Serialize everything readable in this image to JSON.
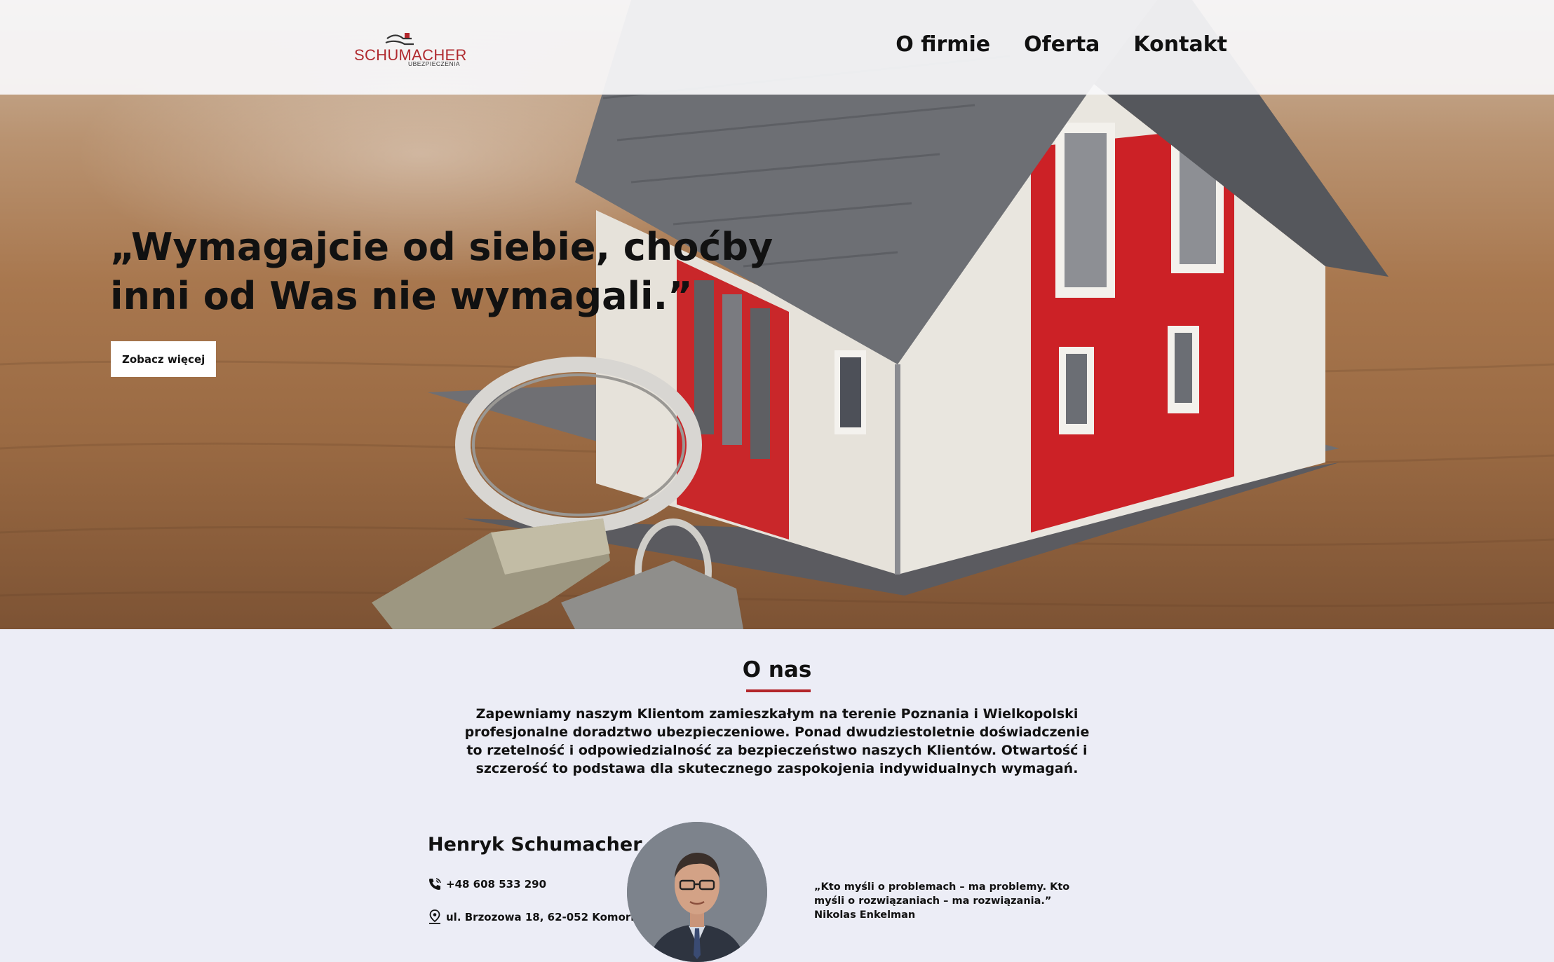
{
  "brand": {
    "name": "SCHUMACHER",
    "sub": "UBEZPIECZENIA",
    "accent": "#b3262b"
  },
  "nav": {
    "items": [
      {
        "label": "O firmie"
      },
      {
        "label": "Oferta"
      },
      {
        "label": "Kontakt"
      }
    ]
  },
  "hero": {
    "quote": "„Wymagajcie od siebie, choćby inni od Was nie wymagali.”",
    "button_label": "Zobacz więcej",
    "image": "house-and-keys-photo"
  },
  "about": {
    "title": "O nas",
    "text": "Zapewniamy naszym Klientom zamieszkałym na terenie Poznania i Wielkopolski profesjonalne doradztwo ubezpieczeniowe. Ponad dwudziestoletnie doświadczenie to rzetelność i odpowiedzialność za bezpieczeństwo naszych Klientów. Otwartość i szczerość to podstawa dla skutecznego zaspokojenia indywidualnych wymagań."
  },
  "person": {
    "name": "Henryk Schumacher",
    "phone": "+48 608 533 290",
    "address": "ul. Brzozowa 18, 62-052 Komorniki",
    "phone_icon": "phone-icon",
    "address_icon": "map-pin-icon",
    "quote": "„Kto myśli o problemach – ma problemy. Kto myśli o rozwiązaniach – ma rozwiązania.” Nikolas Enkelman"
  }
}
